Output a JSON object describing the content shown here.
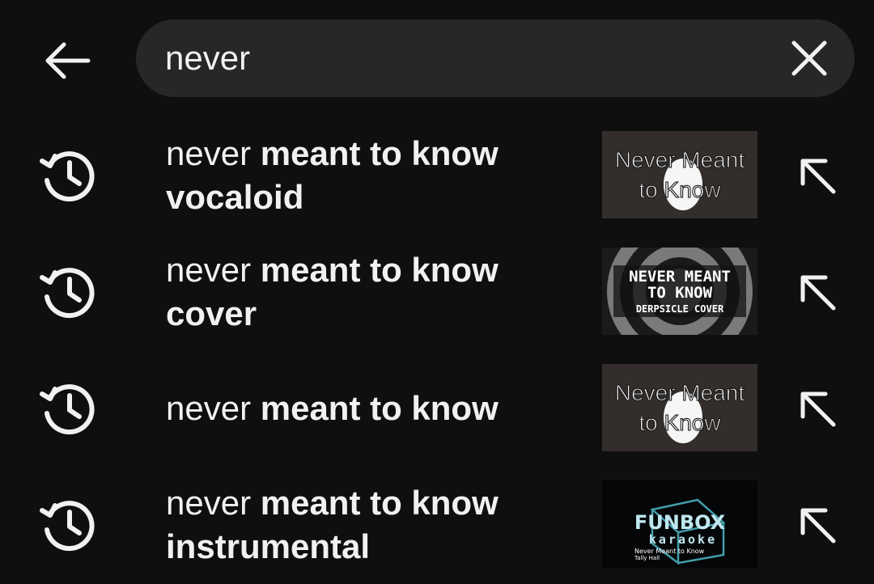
{
  "search": {
    "query": "never",
    "back_icon": "arrow-left-icon",
    "clear_icon": "close-icon"
  },
  "suggestions": [
    {
      "prefix": "never",
      "rest": "meant to know",
      "rest2": "vocaloid",
      "thumbnail": "never-meant-to-know-art",
      "thumb_line1": "Never Meant",
      "thumb_line2": "to Know"
    },
    {
      "prefix": "never",
      "rest": "meant to know",
      "rest2": "cover",
      "thumbnail": "derpsicle-cover-art",
      "thumb_line1": "NEVER MEANT",
      "thumb_line2": "TO KNOW",
      "thumb_line3": "DERPSICLE COVER"
    },
    {
      "prefix": "never",
      "rest": "meant to know",
      "rest2": "",
      "thumbnail": "never-meant-to-know-art",
      "thumb_line1": "Never Meant",
      "thumb_line2": "to Know"
    },
    {
      "prefix": "never",
      "rest": "meant to know",
      "rest2": "instrumental",
      "thumbnail": "funbox-karaoke-art",
      "thumb_line1": "FUNBOX",
      "thumb_line2": "karaoke",
      "thumb_line3": "Never Meant to Know",
      "thumb_line4": "Tally Hall"
    }
  ],
  "colors": {
    "background": "#0f0f0f",
    "pill": "#272727",
    "text": "#f1f1f1"
  }
}
